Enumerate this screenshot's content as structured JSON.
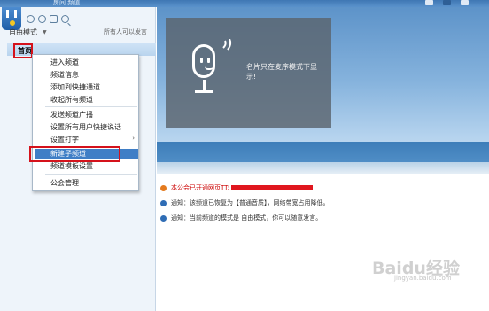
{
  "window": {
    "title": "房间 频道",
    "accent": "#3f77b4"
  },
  "toolbar": {
    "icons": [
      "user-icon",
      "location-icon",
      "chat-icon",
      "search-icon"
    ]
  },
  "mode": {
    "label": "自由模式",
    "hint": "所有人可以发言"
  },
  "channel": {
    "name": "首页"
  },
  "context_menu": {
    "items": [
      {
        "label": "进入频道"
      },
      {
        "label": "频道信息"
      },
      {
        "label": "添加到快捷通道"
      },
      {
        "label": "收起所有频道"
      },
      {
        "label": "发送频道广播"
      },
      {
        "label": "设置所有用户快捷说话"
      },
      {
        "label": "设置打字",
        "submenu": true
      },
      {
        "label": "新建子频道",
        "selected": true
      },
      {
        "label": "频道模板设置"
      },
      {
        "label": "公会管理"
      }
    ]
  },
  "card": {
    "text": "名片只在麦序模式下显示!"
  },
  "notices": [
    {
      "prefix": "本公会已开通网页TT:",
      "type": "warn",
      "redacted": true
    },
    {
      "prefix": "通知：该频道已恢复为【普通音质】，网络带宽占用降低。",
      "type": "info"
    },
    {
      "prefix": "通知：当前频道的模式是 自由模式，你可以随意发言。",
      "type": "info"
    }
  ],
  "watermark": {
    "brand": "Baidu经验",
    "sub": "jingyan.baidu.com"
  },
  "colors": {
    "highlight_red": "#d5121b",
    "menu_selected": "#3f7ec6"
  }
}
